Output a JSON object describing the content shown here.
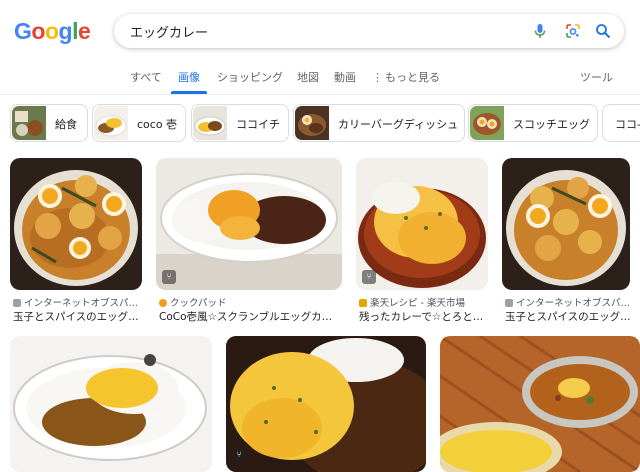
{
  "logo": {
    "letters": [
      "G",
      "o",
      "o",
      "g",
      "l",
      "e"
    ],
    "colors": [
      "#4285F4",
      "#EA4335",
      "#FBBC05",
      "#4285F4",
      "#34A853",
      "#EA4335"
    ]
  },
  "search": {
    "query": "エッグカレー"
  },
  "tabs": [
    {
      "label": "すべて"
    },
    {
      "label": "画像"
    },
    {
      "label": "ショッピング"
    },
    {
      "label": "地図"
    },
    {
      "label": "動画"
    },
    {
      "label": "もっと見る"
    }
  ],
  "tools_label": "ツール",
  "chips": [
    {
      "label": "給食"
    },
    {
      "label": "coco 壱"
    },
    {
      "label": "ココイチ"
    },
    {
      "label": "カリーバーグディッシュ"
    },
    {
      "label": "スコッチエッグ"
    },
    {
      "label": "ココ-"
    }
  ],
  "results": [
    {
      "source": "インターネットオブスパ…",
      "title": "玉子とスパイスのエッグ…"
    },
    {
      "source": "クックパッド",
      "title": "CoCo壱風☆スクランブルエッグカ…"
    },
    {
      "source": "楽天レシピ - 楽天市場",
      "title": "残ったカレーで☆とろと…"
    },
    {
      "source": "インターネットオブスパ…",
      "title": "玉子とスパイスのエッグ…"
    }
  ],
  "colors": {
    "accent": "#1a73e8",
    "curry": "#c9892e",
    "egg": "#f5c242"
  }
}
